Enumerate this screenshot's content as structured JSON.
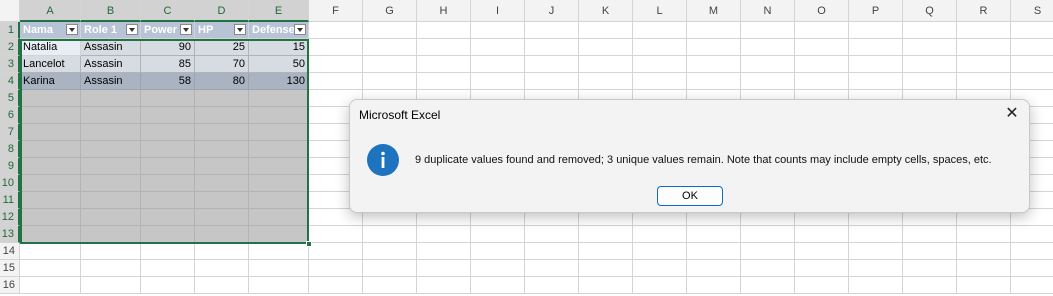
{
  "columns": [
    "A",
    "B",
    "C",
    "D",
    "E",
    "F",
    "G",
    "H",
    "I",
    "J",
    "K",
    "L",
    "M",
    "N",
    "O",
    "P",
    "Q",
    "R",
    "S"
  ],
  "rows": [
    "1",
    "2",
    "3",
    "4",
    "5",
    "6",
    "7",
    "8",
    "9",
    "10",
    "11",
    "12",
    "13",
    "14",
    "15",
    "16"
  ],
  "table": {
    "headers": [
      "Nama",
      "Role 1",
      "Power",
      "HP",
      "Defense"
    ],
    "data": [
      [
        "Natalia",
        "Assasin",
        "90",
        "25",
        "15"
      ],
      [
        "Lancelot",
        "Assasin",
        "85",
        "70",
        "50"
      ],
      [
        "Karina",
        "Assasin",
        "58",
        "80",
        "130"
      ]
    ]
  },
  "dialog": {
    "title": "Microsoft Excel",
    "message": "9 duplicate values found and removed; 3 unique values remain. Note that counts may include empty cells, spaces, etc.",
    "ok_label": "OK",
    "close_glyph": "✕"
  },
  "colors": {
    "accent": "#217346",
    "table_header": "#b8c3d6",
    "info_icon": "#1e73be"
  }
}
